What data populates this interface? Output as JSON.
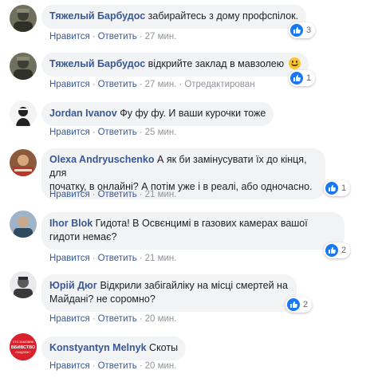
{
  "actions": {
    "like": "Нравится",
    "reply": "Ответить",
    "sep": "·",
    "edited": "Отредактирован"
  },
  "comments": [
    {
      "author": "Тяжелый Барбудос",
      "text": "забирайтесь з дому профспілок.",
      "time": "27 мин.",
      "likes": "3"
    },
    {
      "author": "Тяжелый Барбудос",
      "text": "відкрийте заклад в мавзолею",
      "time": "27 мин.",
      "likes": "1",
      "edited": true
    },
    {
      "author": "Jordan Ivanov",
      "text": "Фу фу фу. И ваши курочки тоже",
      "time": "25 мин."
    },
    {
      "author": "Olexa Andryuschenko",
      "text_line1": "А як би замінусувати їх до кінця, для",
      "text_line2": "початку, в онлайні? А потім уже і в реалі, або одночасно.",
      "time": "21 мин.",
      "likes": "1"
    },
    {
      "author": "Ihor Blok",
      "text_line1": "Гидота! В Освєнцимі в газових камерах вашої",
      "text_line2": "гидоти немає?",
      "time": "21 мин.",
      "likes": "2"
    },
    {
      "author": "Юрій Дюг",
      "text_line1": "Відкрили забігайліку на місці смертей на",
      "text_line2": "Майдані? не соромно?",
      "time": "20 мин.",
      "likes": "2"
    },
    {
      "author": "Konstyantyn Melnyk",
      "text": "Скоты",
      "time": "20 мин."
    }
  ],
  "avatar_text": {
    "c6_line1": "ХТО ЗАМОВИВ",
    "c6_line2": "ВБИВСТВО",
    "c6_line3": "ГАНДЗЮК?"
  },
  "colors": {
    "link": "#385898",
    "bubble": "#f2f3f5",
    "meta": "#90949c",
    "like_blue": "#1877f2"
  }
}
